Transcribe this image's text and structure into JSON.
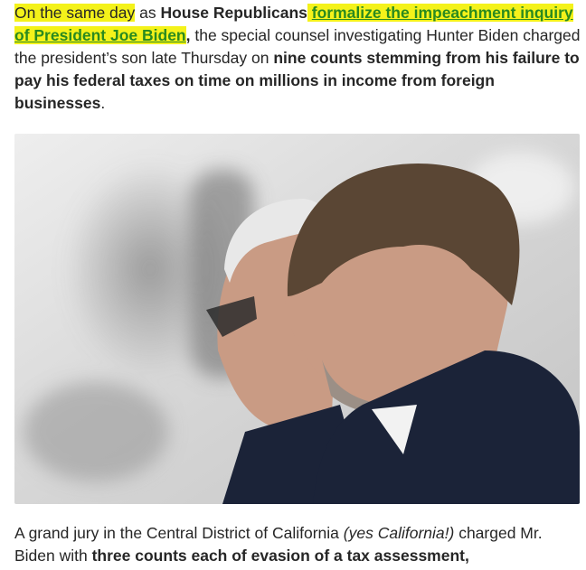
{
  "paragraph1": {
    "part1_highlight": "On the same day",
    "part2": " as ",
    "part3_bold": "House Republicans",
    "link_line1": "formalize the impeachment",
    "link_line2": "inquiry of President Joe Biden",
    "part4_bold": ",",
    "part5": " the special counsel investigating Hunter Biden charged the president’s son late Thursday on ",
    "part6_bold": "nine counts stemming from his failure to pay his federal taxes on time on millions in income from foreign businesses",
    "part7": "."
  },
  "photo": {
    "palette": {
      "background": "#d9d9d9",
      "suit": "#1b2338",
      "hair_left": "#e8e8e8",
      "hair_right": "#5a4634",
      "skin": "#c99b84"
    }
  },
  "paragraph2": {
    "part1": "A grand jury in the Central District of California ",
    "part2_italic": "(yes California!)",
    "part3": " charged Mr. Biden with ",
    "part4_bold": "three counts each of evasion of a tax assessment,"
  },
  "colors": {
    "highlight": "#f4f21a",
    "link": "#2a8a1f",
    "text": "#262626"
  }
}
